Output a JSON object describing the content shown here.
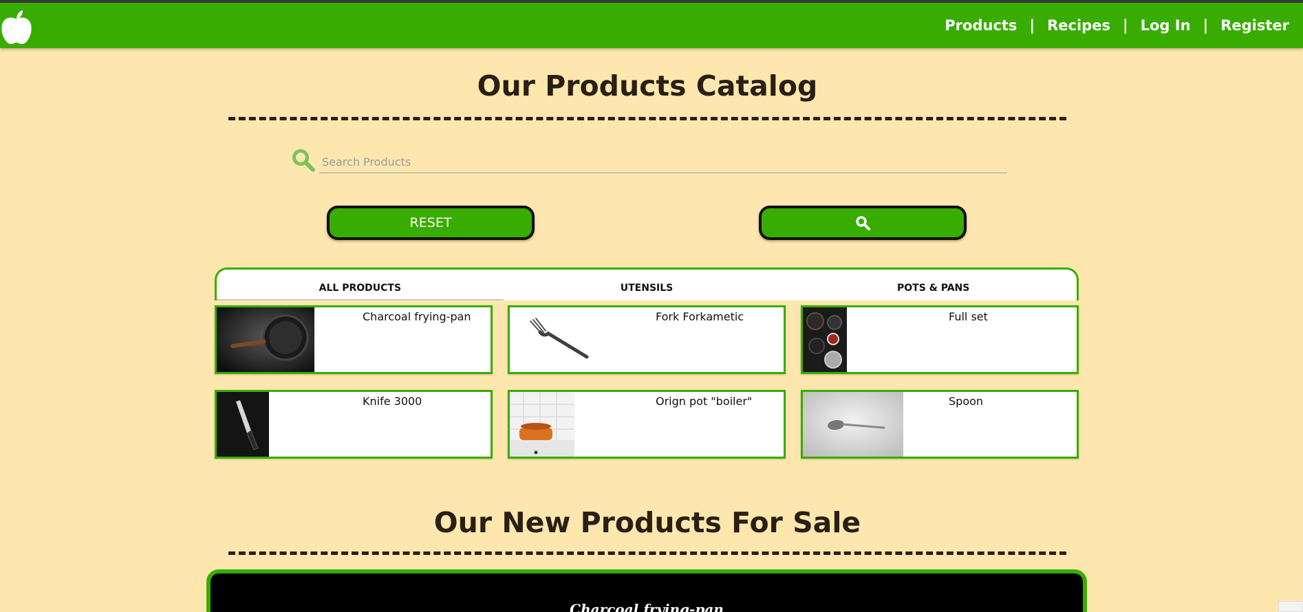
{
  "nav": {
    "links": [
      "Products",
      "Recipes",
      "Log In",
      "Register"
    ],
    "separator": "|"
  },
  "catalog": {
    "title": "Our Products Catalog",
    "search_placeholder": "Search Products",
    "reset_label": "RESET",
    "search_button_icon": "search-icon"
  },
  "tabs": [
    {
      "label": "ALL PRODUCTS",
      "active": true
    },
    {
      "label": "UTENSILS",
      "active": false
    },
    {
      "label": "POTS & PANS",
      "active": false
    }
  ],
  "products": [
    {
      "name": "Charcoal frying-pan",
      "image": "frying-pan-photo"
    },
    {
      "name": "Fork Forkametic",
      "image": "fork-photo"
    },
    {
      "name": "Full set",
      "image": "cookware-set-photo"
    },
    {
      "name": "Knife 3000",
      "image": "knife-photo"
    },
    {
      "name": "Orign pot \"boiler\"",
      "image": "orange-pot-photo"
    },
    {
      "name": "Spoon",
      "image": "spoon-photo"
    }
  ],
  "sale": {
    "title": "Our New Products For Sale",
    "featured_name": "Charcoal frying-pan"
  },
  "colors": {
    "brand_green": "#38ad00",
    "page_background": "#fde7ae",
    "heading": "#2a1f14",
    "search_icon": "#7cc25a"
  }
}
